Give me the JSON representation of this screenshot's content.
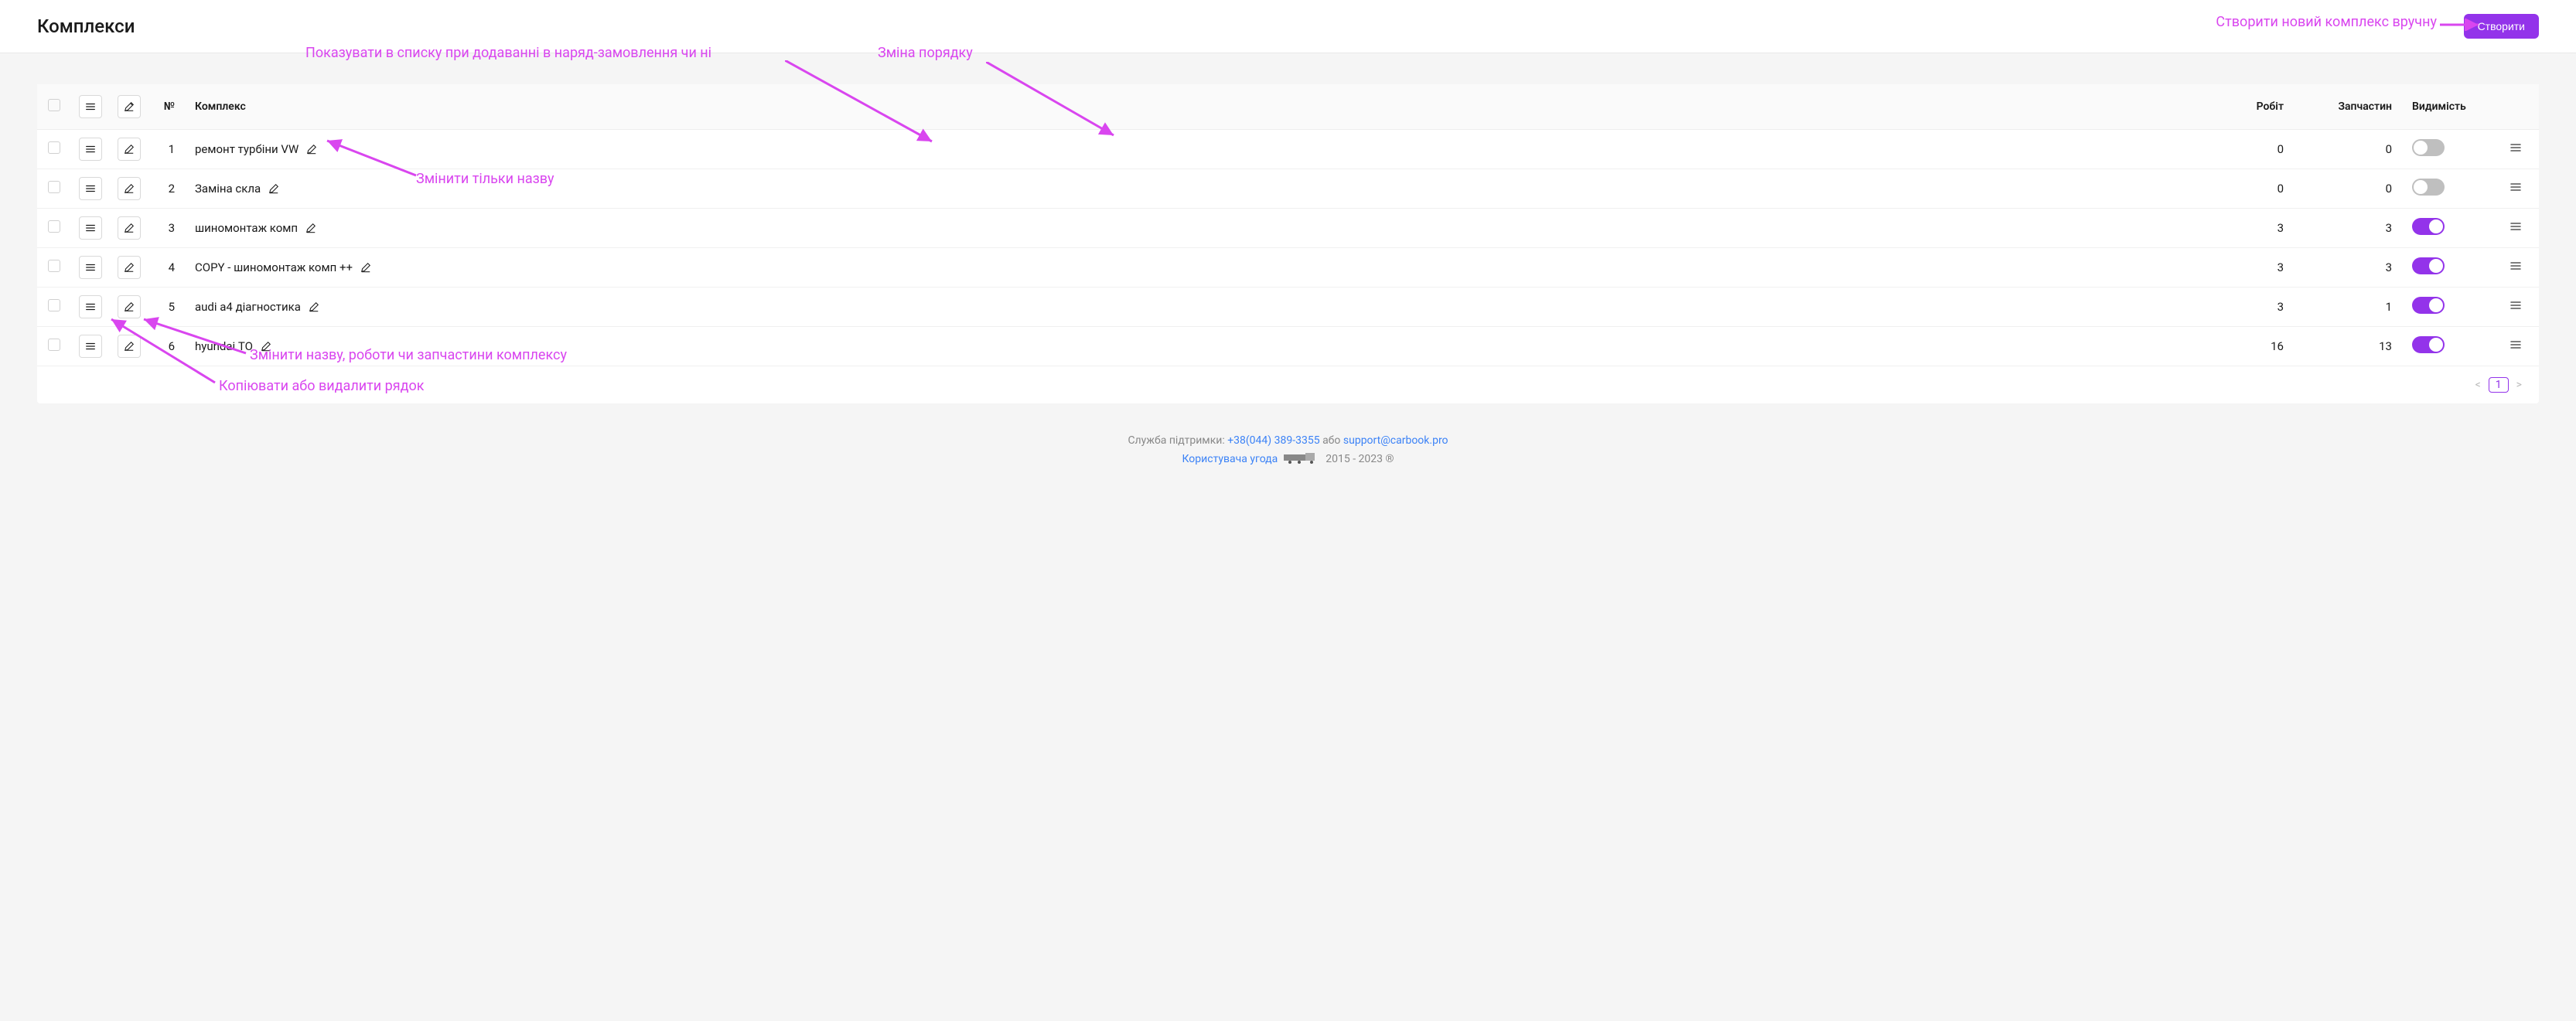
{
  "header": {
    "title": "Комплекси",
    "create_label": "Створити"
  },
  "annotations": {
    "create_manual": "Створити новий комплекс вручну",
    "show_in_list": "Показувати в списку при додаванні в наряд-замовлення чи ні",
    "reorder": "Зміна порядку",
    "rename_only": "Змінити тільки назву",
    "edit_full": "Змінити назву, роботи чи запчастини комплексу",
    "copy_delete": "Копіювати або видалити рядок"
  },
  "table": {
    "columns": {
      "num": "№",
      "complex": "Комплекс",
      "works": "Робіт",
      "parts": "Запчастин",
      "visibility": "Видимість"
    },
    "rows": [
      {
        "num": 1,
        "name": "ремонт турбіни VW",
        "works": 0,
        "parts": 0,
        "visible": false
      },
      {
        "num": 2,
        "name": "Заміна скла",
        "works": 0,
        "parts": 0,
        "visible": false
      },
      {
        "num": 3,
        "name": "шиномонтаж комп",
        "works": 3,
        "parts": 3,
        "visible": true
      },
      {
        "num": 4,
        "name": "COPY - шиномонтаж комп ++",
        "works": 3,
        "parts": 3,
        "visible": true
      },
      {
        "num": 5,
        "name": "audi a4 діагностика",
        "works": 3,
        "parts": 1,
        "visible": true
      },
      {
        "num": 6,
        "name": "hyundai ТО",
        "works": 16,
        "parts": 13,
        "visible": true
      }
    ]
  },
  "pagination": {
    "current": "1"
  },
  "footer": {
    "support_prefix": "Служба підтримки: ",
    "phone": "+38(044) 389-3355",
    "or": " або ",
    "email": "support@carbook.pro",
    "agreement": "Користувача угода",
    "years": "2015 - 2023 ®"
  }
}
